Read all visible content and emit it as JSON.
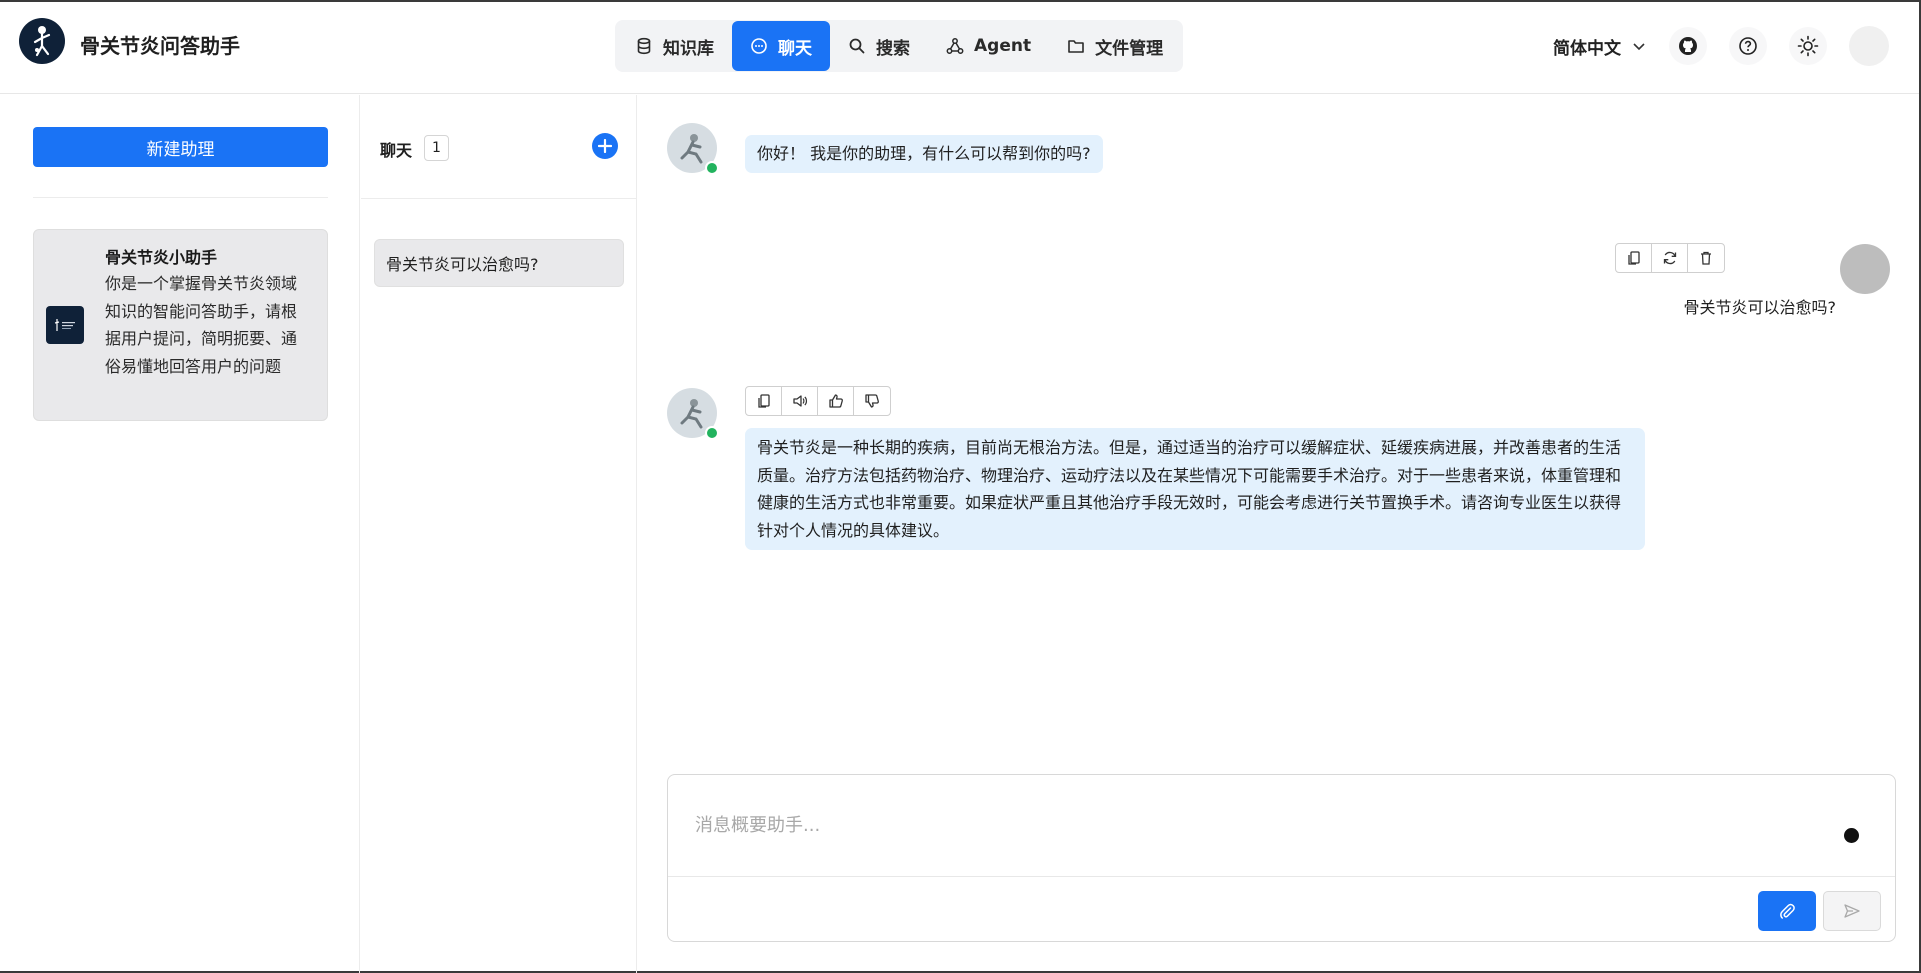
{
  "header": {
    "app_title": "骨关节炎问答助手",
    "nav": [
      {
        "label": "知识库",
        "icon": "database-icon",
        "active": false
      },
      {
        "label": "聊天",
        "icon": "chat-icon",
        "active": true
      },
      {
        "label": "搜索",
        "icon": "search-icon",
        "active": false
      },
      {
        "label": "Agent",
        "icon": "agent-icon",
        "active": false
      },
      {
        "label": "文件管理",
        "icon": "folder-icon",
        "active": false
      }
    ],
    "language": "简体中文"
  },
  "sidebar": {
    "new_assistant_label": "新建助理",
    "assistant": {
      "name": "骨关节炎小助手",
      "description": "你是一个掌握骨关节炎领域知识的智能问答助手，请根据用户提问，简明扼要、通俗易懂地回答用户的问题"
    }
  },
  "chatlist": {
    "title": "聊天",
    "count": "1",
    "items": [
      {
        "title": "骨关节炎可以治愈吗?"
      }
    ]
  },
  "conversation": {
    "greeting": "你好！ 我是你的助理，有什么可以帮到你的吗?",
    "user_message": "骨关节炎可以治愈吗?",
    "answer": "骨关节炎是一种长期的疾病，目前尚无根治方法。但是，通过适当的治疗可以缓解症状、延缓疾病进展，并改善患者的生活质量。治疗方法包括药物治疗、物理治疗、运动疗法以及在某些情况下可能需要手术治疗。对于一些患者来说，体重管理和健康的生活方式也非常重要。如果症状严重且其他治疗手段无效时，可能会考虑进行关节置换手术。请咨询专业医生以获得针对个人情况的具体建议。"
  },
  "input": {
    "placeholder": "消息概要助手..."
  },
  "colors": {
    "accent": "#1a73f5",
    "bubble": "#e3f1fd",
    "online": "#22b35e"
  }
}
